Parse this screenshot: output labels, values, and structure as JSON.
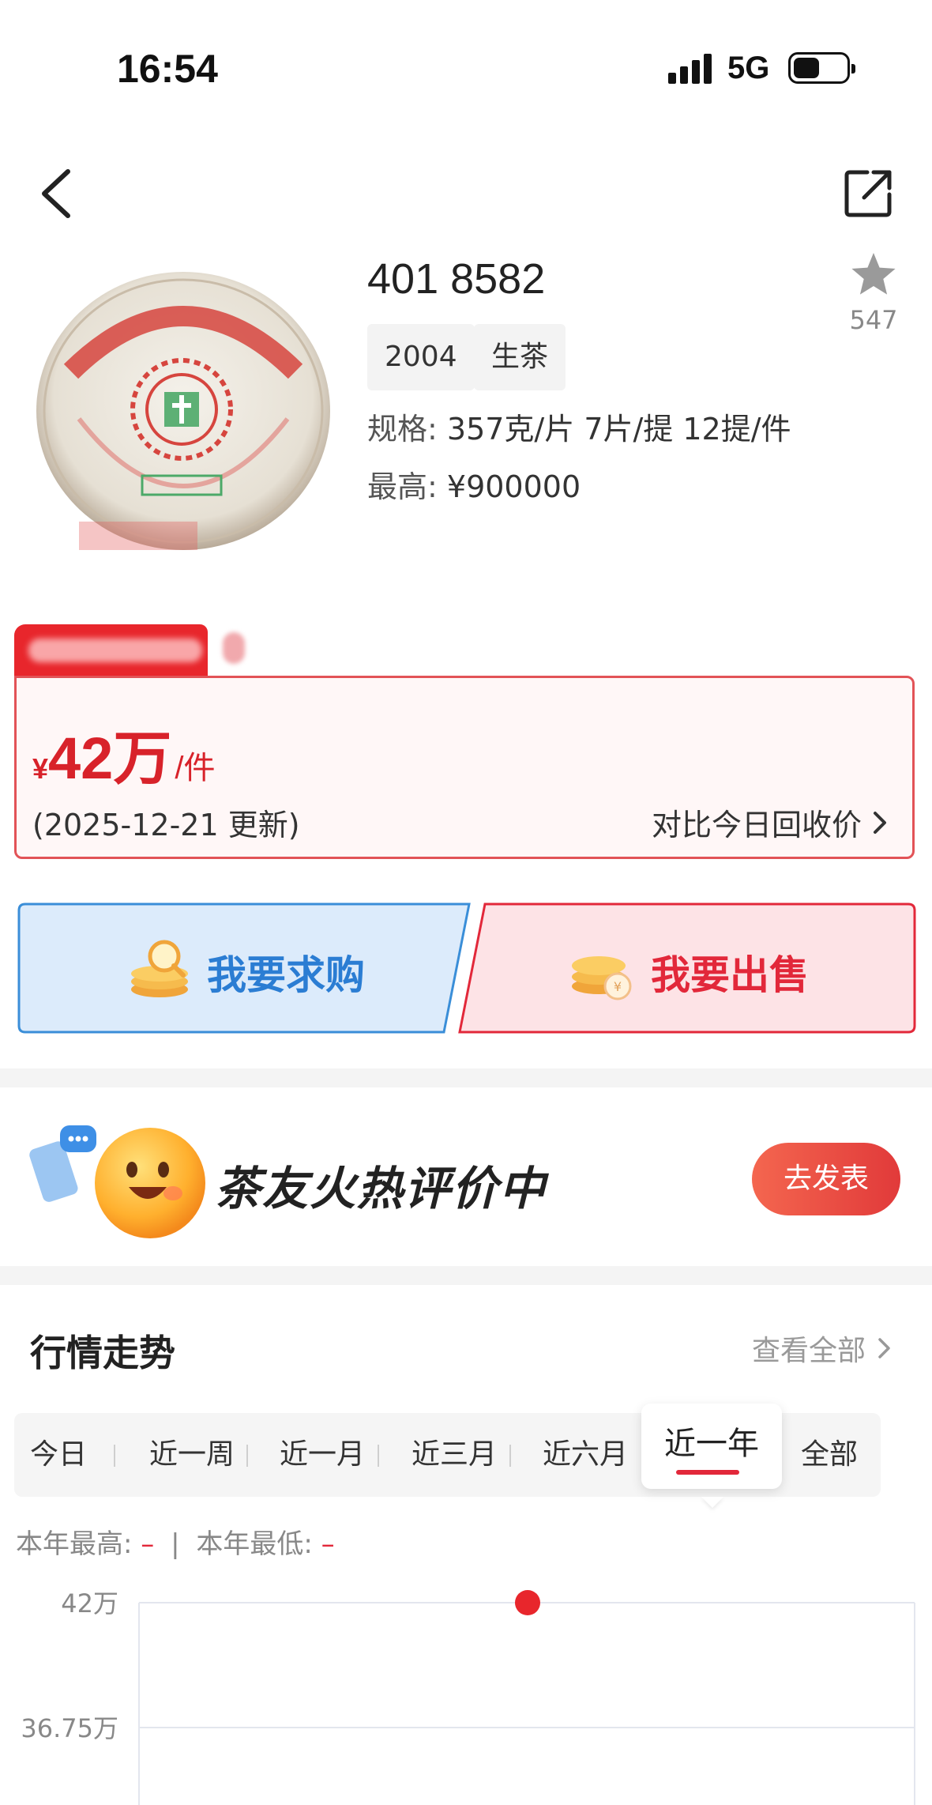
{
  "status_bar": {
    "time": "16:54",
    "network": "5G"
  },
  "nav": {
    "back_icon": "chevron-left-icon",
    "share_icon": "share-icon"
  },
  "product": {
    "title": "401 8582",
    "tags": [
      "2004",
      "生茶"
    ],
    "spec_label": "规格:",
    "spec_value": "357克/片 7片/提 12提/件",
    "max_label": "最高:",
    "max_value": "¥900000",
    "favorite_count": "547",
    "image_icon": "tea-cake-image"
  },
  "price_card": {
    "currency": "¥",
    "price": "42万",
    "unit": "/件",
    "updated": "(2025-12-21 更新)",
    "compare_label": "对比今日回收价"
  },
  "actions": {
    "buy_label": "我要求购",
    "sell_label": "我要出售"
  },
  "review": {
    "title": "茶友火热评价中",
    "button": "去发表"
  },
  "trend": {
    "title": "行情走势",
    "view_all": "查看全部",
    "periods": [
      "今日",
      "近一周",
      "近一月",
      "近三月",
      "近六月",
      "近一年",
      "全部"
    ],
    "active_period": "近一年",
    "year_high_label": "本年最高:",
    "year_high_value": "–",
    "year_low_label": "本年最低:",
    "year_low_value": "–"
  },
  "colors": {
    "accent_red": "#e2283a",
    "buy_blue": "#2b7dd3",
    "price_red": "#d8222a"
  },
  "chart_data": {
    "type": "line",
    "y_ticks": [
      "42万",
      "36.75万"
    ],
    "series": [
      {
        "values": [
          42
        ]
      }
    ],
    "grid": true
  }
}
